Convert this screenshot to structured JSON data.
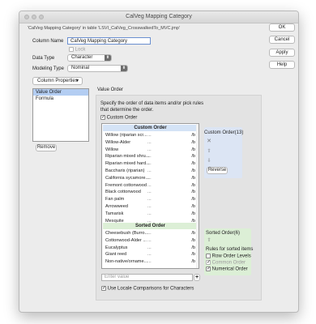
{
  "window": {
    "title": "CalVeg Mapping Category",
    "subtitle": "'CalVeg Mapping Category' in table 'LSVI_CalVeg_CrosswalkedTo_MVC.jmp'"
  },
  "actions": {
    "ok": "OK",
    "cancel": "Cancel",
    "apply": "Apply",
    "help": "Help"
  },
  "column": {
    "name_label": "Column Name",
    "name_value": "CalVeg Mapping Category",
    "lock_label": "Lock",
    "data_type_label": "Data Type",
    "data_type_value": "Character",
    "modeling_type_label": "Modeling Type",
    "modeling_type_value": "Nominal",
    "properties_label": "Column Properties"
  },
  "properties": {
    "items": [
      "Value Order",
      "Formula"
    ],
    "selected": "Value Order",
    "remove_label": "Remove"
  },
  "value_order": {
    "section_title": "Value Order",
    "description": "Specify the order of data items and/or pick rules that determine the order.",
    "custom_order_check": "Custom Order",
    "custom_header": "Custom Order",
    "custom_items": [
      {
        "name": "Willow (riparian scr...",
        "code": "/b"
      },
      {
        "name": "Willow-Alder",
        "code": "/b"
      },
      {
        "name": "Willow",
        "code": "/b"
      },
      {
        "name": "Riparian mixed shru...",
        "code": "/b"
      },
      {
        "name": "Riparian mixed hard...",
        "code": "/b"
      },
      {
        "name": "Baccharis (riparian)",
        "code": "/b"
      },
      {
        "name": "California sycamore...",
        "code": "/b"
      },
      {
        "name": "Fremont cottonwood",
        "code": "/b"
      },
      {
        "name": "Black cottonwood",
        "code": "/b"
      },
      {
        "name": "Fan palm",
        "code": "/b"
      },
      {
        "name": "Arrowweed",
        "code": "/b"
      },
      {
        "name": "Tamarisk",
        "code": "/b"
      },
      {
        "name": "Mesquite",
        "code": "/b"
      }
    ],
    "sorted_header": "Sorted Order",
    "sorted_items": [
      {
        "name": "Cheesebush (Burro...",
        "code": "/b"
      },
      {
        "name": "Cottonwood-Alder ...",
        "code": "/b"
      },
      {
        "name": "Eucalyptus",
        "code": "/b"
      },
      {
        "name": "Giant reed",
        "code": "/b"
      },
      {
        "name": "Non-native/orname...",
        "code": "/b"
      }
    ],
    "ellipsis": "...",
    "enter_placeholder": "Enter value",
    "add_symbol": "+",
    "locale_label": "Use Locale Comparisons for Characters",
    "custom_panel_title": "Custom Order(13)",
    "reverse_label": "Reverse",
    "sorted_panel_title": "Sorted Order(6)",
    "rules_title": "Rules for sorted items",
    "rules": {
      "row_order": "Row Order Levels",
      "common_order": "Common Order",
      "numerical_order": "Numerical Order"
    },
    "rules_state": {
      "row_order": false,
      "common_order": true,
      "numerical_order": true
    }
  }
}
